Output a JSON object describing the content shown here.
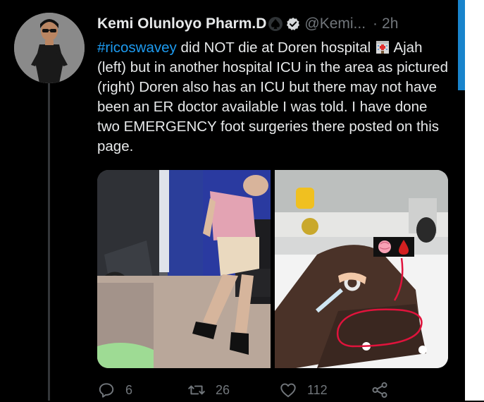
{
  "tweet": {
    "display_name": "Kemi Olunloyo Pharm.D",
    "handle": "@Kemi...",
    "separator": "·",
    "time": "2h",
    "more": "···",
    "text": {
      "hashtag": "#ricoswavey",
      "part1": " did NOT die at Doren hospital ",
      "part2": " Ajah (left) but in another hospital ICU in the area as pictured (right) Doren also has an ICU but there may not have been an ER doctor available I was told. I have done two EMERGENCY foot surgeries there posted on this page."
    }
  },
  "actions": {
    "replies": "6",
    "retweets": "26",
    "likes": "112"
  },
  "icons": [
    "avatar",
    "spade-icon",
    "verified-badge-icon",
    "hospital-emoji-icon",
    "brain-emoji-icon",
    "blood-drop-emoji-icon",
    "reply-icon",
    "retweet-icon",
    "like-icon",
    "share-icon"
  ],
  "colors": {
    "background": "#000000",
    "text": "#e7e9ea",
    "secondary": "#71767b",
    "accent": "#1d9bf0"
  }
}
